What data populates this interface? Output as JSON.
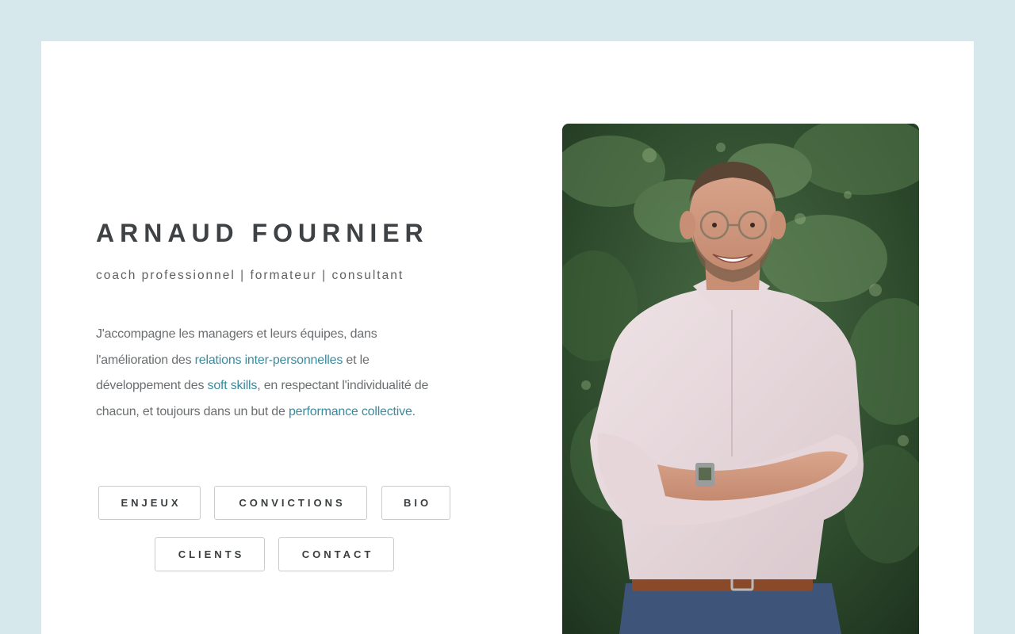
{
  "profile": {
    "name": "ARNAUD FOURNIER",
    "tagline": "coach professionnel | formateur | consultant"
  },
  "intro": {
    "part1": "J'accompagne les managers et leurs équipes, dans l'amélioration des ",
    "highlight1": "relations inter-personnelles",
    "part2": " et le développement des ",
    "highlight2": "soft skills",
    "part3": ", en respectant l'individualité de chacun, et toujours dans un but de ",
    "highlight3": "performance collective",
    "part4": "."
  },
  "nav": {
    "enjeux": "ENJEUX",
    "convictions": "CONVICTIONS",
    "bio": "BIO",
    "clients": "CLIENTS",
    "contact": "CONTACT"
  },
  "colors": {
    "page_background": "#d7e8ec",
    "card_background": "#ffffff",
    "accent": "#3b8a9e",
    "heading": "#3f4244",
    "body_text": "#6b6e70"
  },
  "photo": {
    "icon": "portrait-photo"
  }
}
